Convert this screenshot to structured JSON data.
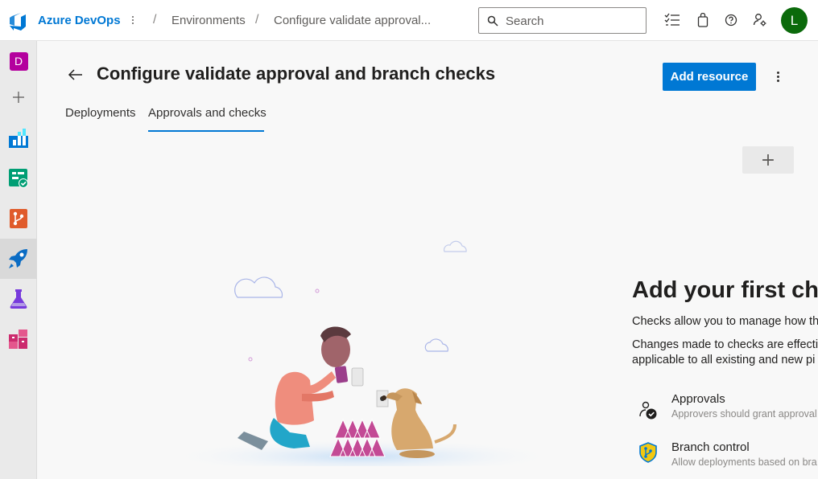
{
  "topbar": {
    "brand": "Azure DevOps",
    "breadcrumbs": [
      "Environments",
      "Configure validate approval..."
    ],
    "search_placeholder": "Search",
    "avatar_initial": "L"
  },
  "rail": {
    "project_initial": "D"
  },
  "header": {
    "title": "Configure validate approval and branch checks",
    "add_resource_label": "Add resource",
    "add_check_label": "+"
  },
  "tabs": [
    {
      "label": "Deployments",
      "selected": false
    },
    {
      "label": "Approvals and checks",
      "selected": true
    }
  ],
  "empty_state": {
    "title": "Add your first chec",
    "line1": "Checks allow you to manage how th",
    "line2": "Changes made to checks are effectiv",
    "line3": "applicable to all existing and new pi",
    "checks": [
      {
        "name": "Approvals",
        "description": "Approvers should grant approval",
        "icon": "approvals-icon"
      },
      {
        "name": "Branch control",
        "description": "Allow deployments based on bra",
        "icon": "branch-control-icon"
      }
    ]
  },
  "colors": {
    "accent": "#0078d4",
    "avatar": "#0b6a0b",
    "project_badge": "#b4009e"
  }
}
